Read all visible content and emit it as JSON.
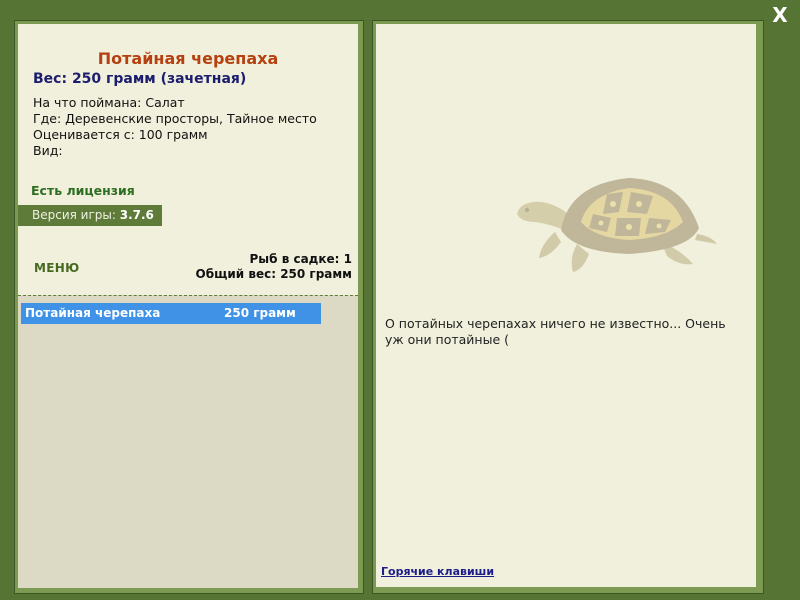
{
  "window": {
    "close_label": "X"
  },
  "fish": {
    "title": "Потайная черепаха",
    "weight_line": "Вес: 250 грамм (зачетная)",
    "caught_on": "На что поймана: Салат",
    "where": "Где: Деревенские просторы, Тайное место",
    "rated_from": "Оценивается с: 100 грамм",
    "kind": "Вид:"
  },
  "license": "Есть лицензия",
  "version": {
    "label": "Версия игры:",
    "value": "3.7.6"
  },
  "menu_label": "МЕНЮ",
  "keepnet": {
    "count": "Рыб в садке: 1",
    "total": "Общий вес: 250 грамм"
  },
  "catch_list": [
    {
      "name": "Потайная черепаха",
      "weight": "250 грамм"
    }
  ],
  "description": "О потайных черепахах ничего не известно... Очень уж они потайные (",
  "hotkeys_label": "Горячие клавиши",
  "colors": {
    "background": "#567535",
    "panel": "#f1f0dc",
    "title": "#b4410f",
    "weight": "#1c1d6d",
    "selection": "#3f92e6"
  }
}
